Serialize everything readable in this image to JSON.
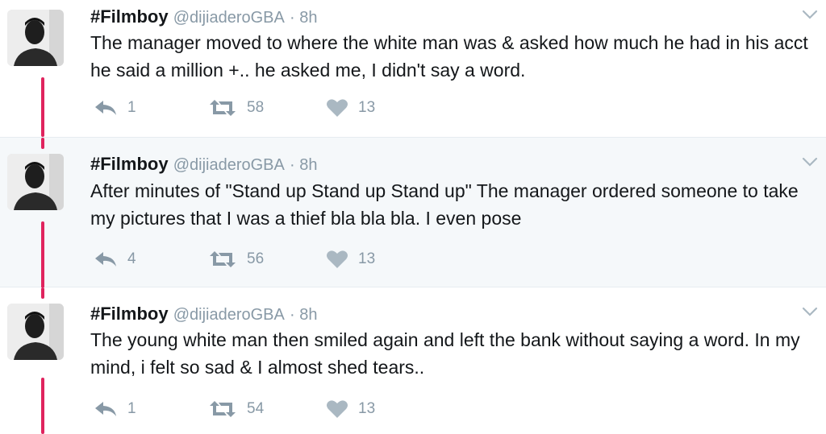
{
  "tweets": [
    {
      "name": "#Filmboy",
      "handle": "@dijiaderoGBA",
      "time": "· 8h",
      "text": "The manager moved to where the white man was & asked how much he had in his acct he said a million +.. he asked me, I didn't say a word.",
      "replies": "1",
      "retweets": "58",
      "likes": "13"
    },
    {
      "name": "#Filmboy",
      "handle": "@dijiaderoGBA",
      "time": "· 8h",
      "text": "After minutes of \"Stand up Stand up Stand up\" The manager ordered someone to take my pictures that I was a thief bla bla bla. I even pose",
      "replies": "4",
      "retweets": "56",
      "likes": "13"
    },
    {
      "name": "#Filmboy",
      "handle": "@dijiaderoGBA",
      "time": "· 8h",
      "text": "The young white man then smiled again and left the bank without saying a word. In my mind, i felt so sad & I almost shed tears..",
      "replies": "1",
      "retweets": "54",
      "likes": "13"
    }
  ],
  "colors": {
    "thread_line": "#e0245e",
    "muted": "#8899a6",
    "highlight_bg": "#f5f8fa"
  },
  "icons": [
    "reply-icon",
    "retweet-icon",
    "like-icon",
    "chevron-down-icon"
  ]
}
